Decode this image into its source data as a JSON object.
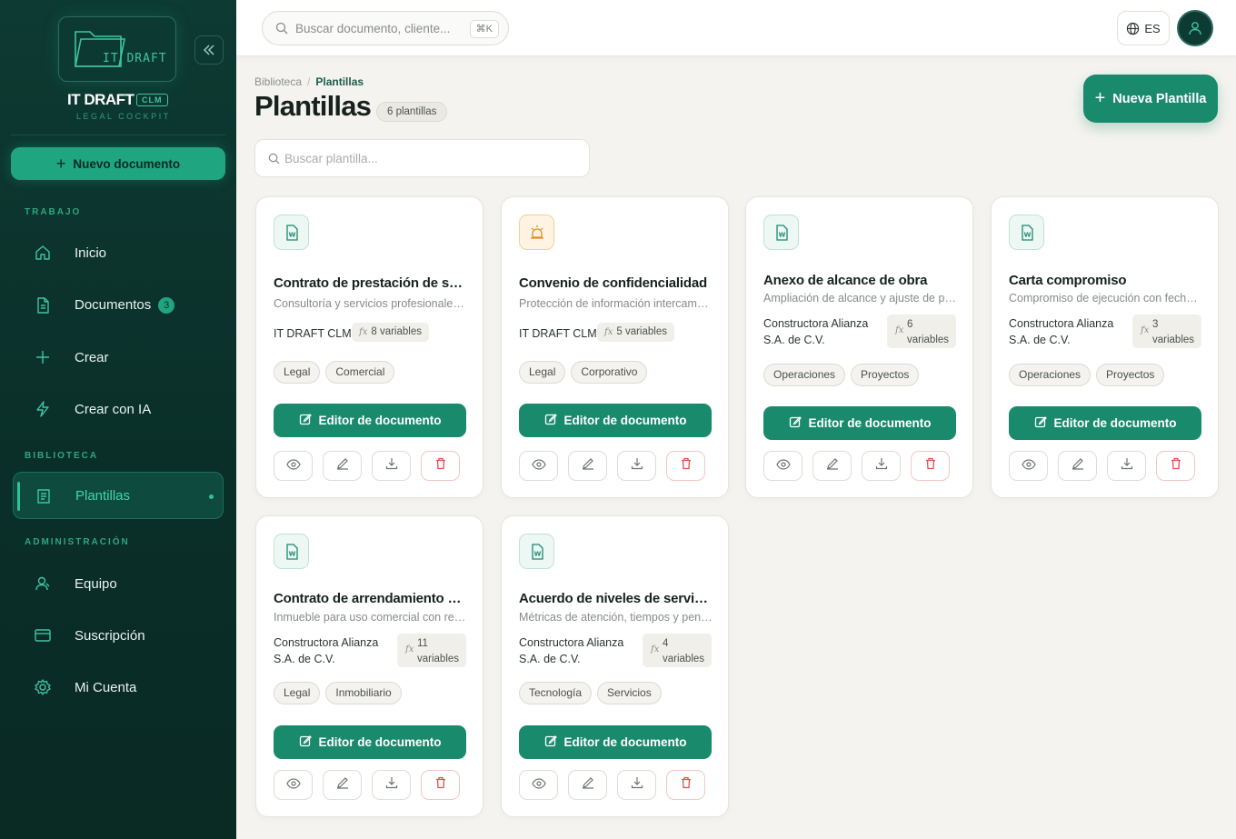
{
  "brand": {
    "logo_text": "IT DRAFT",
    "name": "IT DRAFT",
    "badge": "CLM",
    "subtitle": "LEGAL COCKPIT"
  },
  "sidebar": {
    "new_doc_label": "Nuevo documento",
    "sections": {
      "trabajo": "TRABAJO",
      "biblioteca": "BIBLIOTECA",
      "admin": "ADMINISTRACIÓN"
    },
    "items": [
      {
        "label": "Inicio",
        "icon": "home-icon"
      },
      {
        "label": "Documentos",
        "icon": "document-icon",
        "count": "3"
      },
      {
        "label": "Crear",
        "icon": "plus-icon"
      },
      {
        "label": "Crear con IA",
        "icon": "lightning-icon"
      },
      {
        "label": "Plantillas",
        "icon": "template-icon",
        "active": true
      },
      {
        "label": "Equipo",
        "icon": "team-icon"
      },
      {
        "label": "Suscripción",
        "icon": "card-icon"
      },
      {
        "label": "Mi Cuenta",
        "icon": "gear-icon"
      }
    ]
  },
  "topbar": {
    "search_placeholder": "Buscar documento, cliente...",
    "shortcut": "⌘K",
    "language": "ES"
  },
  "page": {
    "breadcrumb_root": "Biblioteca",
    "breadcrumb_current": "Plantillas",
    "title": "Plantillas",
    "count_badge": "6 plantillas",
    "new_button": "Nueva Plantilla",
    "search_placeholder": "Buscar plantilla..."
  },
  "cards": [
    {
      "title": "Contrato de prestación de servicios",
      "desc": "Consultoría y servicios profesionales por proyecto",
      "owner": "IT DRAFT CLM",
      "vars_num": "8",
      "vars_word": "variables",
      "tags": [
        "Legal",
        "Comercial"
      ],
      "editor_label": "Editor de documento",
      "icon": "word-file-icon"
    },
    {
      "title": "Convenio de confidencialidad",
      "desc": "Protección de información intercambiada entre partes",
      "owner": "IT DRAFT CLM",
      "vars_num": "5",
      "vars_word": "variables",
      "tags": [
        "Legal",
        "Corporativo"
      ],
      "editor_label": "Editor de documento",
      "icon": "alarm-icon"
    },
    {
      "title": "Anexo de alcance de obra",
      "desc": "Ampliación de alcance y ajuste de presupuesto",
      "owner": "Constructora Alianza S.A. de C.V.",
      "vars_num": "6",
      "vars_word": "variables",
      "tags": [
        "Operaciones",
        "Proyectos"
      ],
      "editor_label": "Editor de documento",
      "icon": "word-file-icon"
    },
    {
      "title": "Carta compromiso",
      "desc": "Compromiso de ejecución con fechas de entrega",
      "owner": "Constructora Alianza S.A. de C.V.",
      "vars_num": "3",
      "vars_word": "variables",
      "tags": [
        "Operaciones",
        "Proyectos"
      ],
      "editor_label": "Editor de documento",
      "icon": "word-file-icon"
    },
    {
      "title": "Contrato de arrendamiento comercial",
      "desc": "Inmueble para uso comercial con renta mensual",
      "owner": "Constructora Alianza S.A. de C.V.",
      "vars_num": "11",
      "vars_word": "variables",
      "tags": [
        "Legal",
        "Inmobiliario"
      ],
      "editor_label": "Editor de documento",
      "icon": "word-file-icon"
    },
    {
      "title": "Acuerdo de niveles de servicio",
      "desc": "Métricas de atención, tiempos y penalizaciones",
      "owner": "Constructora Alianza S.A. de C.V.",
      "vars_num": "4",
      "vars_word": "variables",
      "tags": [
        "Tecnología",
        "Servicios"
      ],
      "editor_label": "Editor de documento",
      "icon": "word-file-icon"
    }
  ],
  "colors": {
    "sidebar_bg": "#0d3a32",
    "accent": "#1a8a6d",
    "accent_bright": "#1fa57f",
    "delete": "#d9534f"
  }
}
